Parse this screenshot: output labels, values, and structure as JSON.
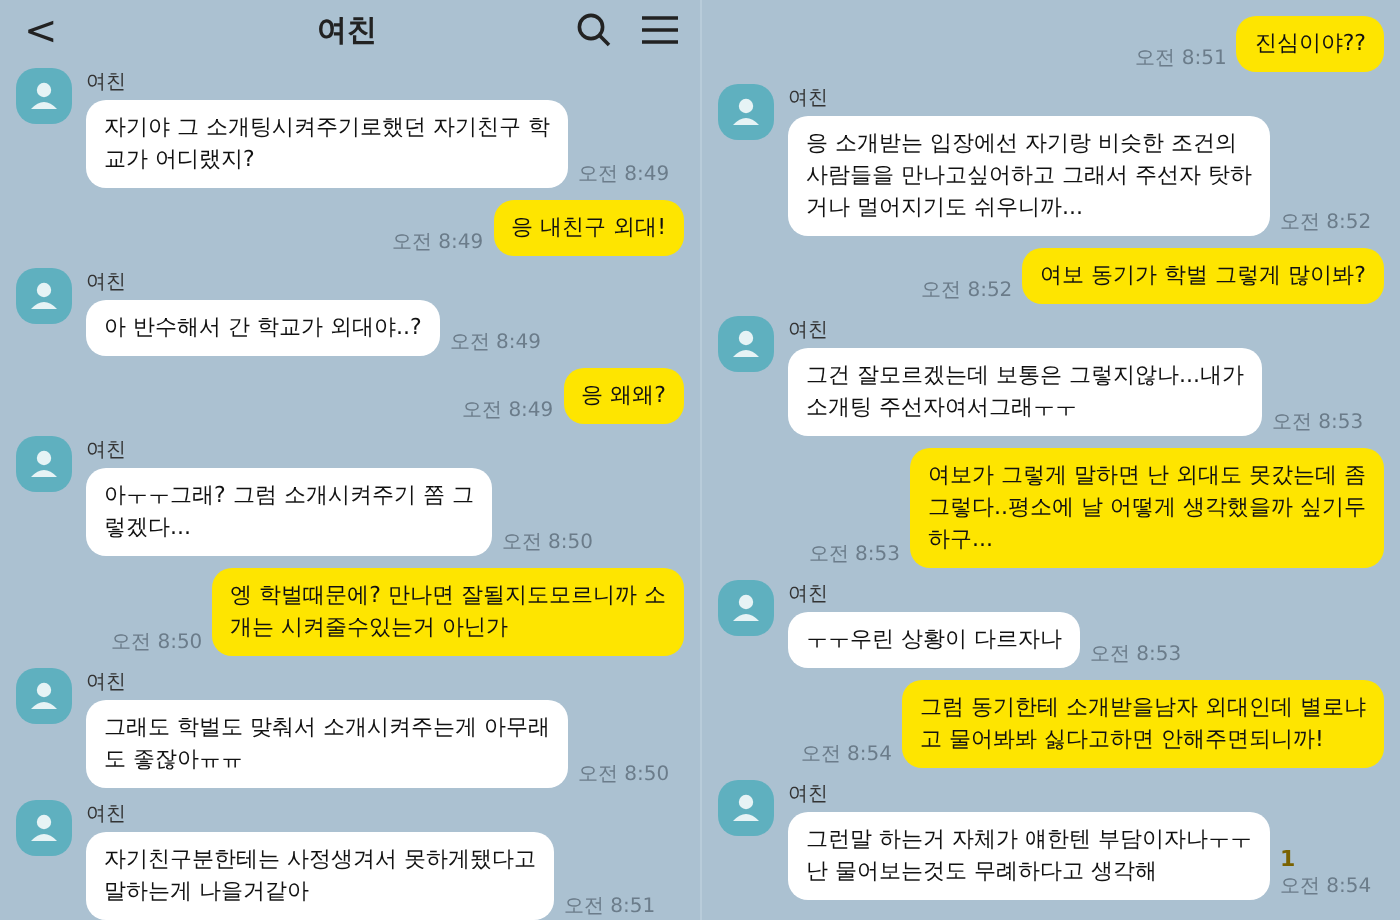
{
  "panels": [
    {
      "header": {
        "back": "<",
        "title": "여친"
      },
      "messages": [
        {
          "kind": "received",
          "sender": "여친",
          "text": "자기야 그 소개팅시켜주기로했던 자기친구 학\n교가 어디랬지?",
          "time": "오전 8:49"
        },
        {
          "kind": "sent",
          "text": "응 내친구 외대!",
          "time": "오전 8:49"
        },
        {
          "kind": "received",
          "sender": "여친",
          "text": "아 반수해서 간 학교가 외대야..?",
          "time": "오전 8:49"
        },
        {
          "kind": "sent",
          "text": "응 왜왜?",
          "time": "오전 8:49"
        },
        {
          "kind": "received",
          "sender": "여친",
          "text": "아ㅜㅜ그래? 그럼 소개시켜주기 쫌 그\n렇겠다...",
          "time": "오전 8:50"
        },
        {
          "kind": "sent",
          "text": "엥 학벌때문에? 만나면 잘될지도모르니까 소\n개는 시켜줄수있는거 아닌가",
          "time": "오전 8:50"
        },
        {
          "kind": "received",
          "sender": "여친",
          "text": "그래도 학벌도 맞춰서 소개시켜주는게 아무래\n도 좋잖아ㅠㅠ",
          "time": "오전 8:50"
        },
        {
          "kind": "received",
          "sender": "여친",
          "text": "자기친구분한테는 사정생겨서 못하게됐다고\n말하는게 나을거같아",
          "time": "오전 8:51"
        }
      ]
    },
    {
      "messages": [
        {
          "kind": "sent",
          "text": "진심이야??",
          "time": "오전 8:51"
        },
        {
          "kind": "received",
          "sender": "여친",
          "text": "응 소개받는 입장에선 자기랑 비슷한 조건의\n사람들을 만나고싶어하고 그래서 주선자 탓하\n거나 멀어지기도 쉬우니까...",
          "time": "오전 8:52"
        },
        {
          "kind": "sent",
          "text": "여보 동기가 학벌 그렇게 많이봐?",
          "time": "오전 8:52"
        },
        {
          "kind": "received",
          "sender": "여친",
          "text": "그건 잘모르겠는데 보통은 그렇지않나...내가\n소개팅 주선자여서그래ㅜㅜ",
          "time": "오전 8:53"
        },
        {
          "kind": "sent",
          "text": "여보가 그렇게 말하면 난 외대도 못갔는데 좀\n그렇다..평소에 날 어떻게 생각했을까 싶기두\n하구...",
          "time": "오전 8:53"
        },
        {
          "kind": "received",
          "sender": "여친",
          "text": "ㅜㅜ우린 상황이 다르자나",
          "time": "오전 8:53"
        },
        {
          "kind": "sent",
          "text": "그럼 동기한테 소개받을남자 외대인데 별로냐\n고 물어봐봐 싫다고하면 안해주면되니까!",
          "time": "오전 8:54"
        },
        {
          "kind": "received",
          "sender": "여친",
          "text": "그런말 하는거 자체가 얘한텐 부담이자나ㅜㅜ\n난 물어보는것도 무례하다고 생각해",
          "time": "오전 8:54",
          "unread": "1"
        }
      ]
    }
  ]
}
